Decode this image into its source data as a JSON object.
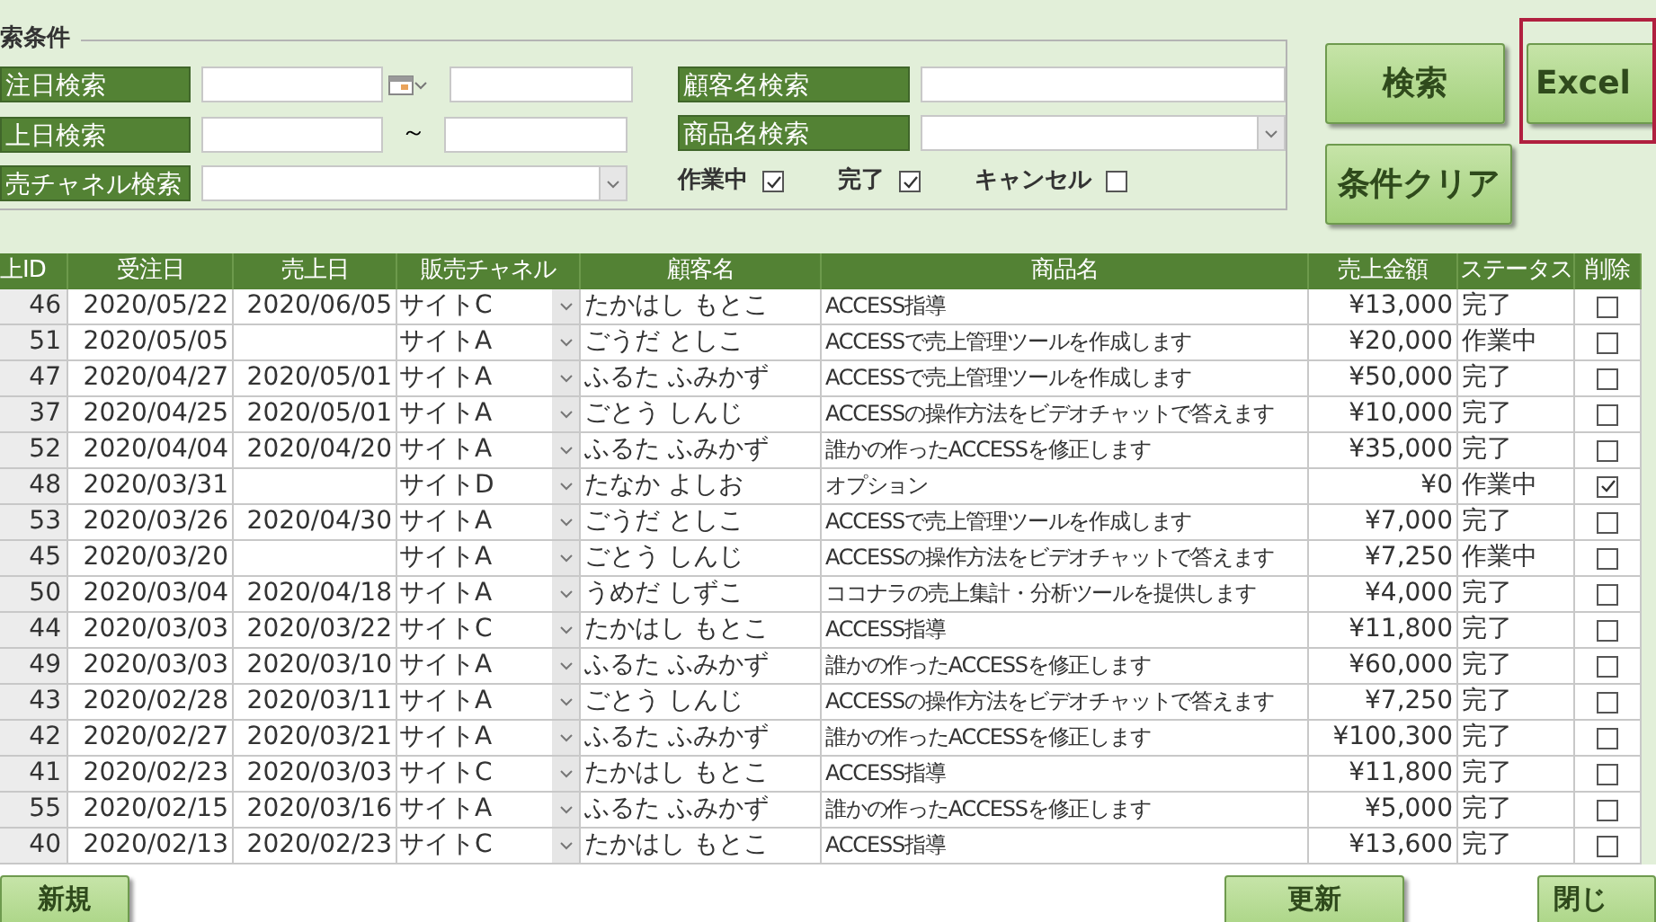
{
  "search_panel": {
    "legend": "索条件",
    "order_date": {
      "label": "注日検索"
    },
    "sales_date": {
      "label": "上日検索",
      "separator": "～"
    },
    "channel": {
      "label": "売チャネル検索"
    },
    "customer": {
      "label": "顧客名検索"
    },
    "product": {
      "label": "商品名検索"
    },
    "status_filters": [
      {
        "label": "作業中",
        "checked": true
      },
      {
        "label": "完了",
        "checked": true
      },
      {
        "label": "キャンセル",
        "checked": false
      }
    ]
  },
  "buttons": {
    "search": "検索",
    "excel": "Excel",
    "clear": "条件クリア"
  },
  "table": {
    "columns": [
      "上ID",
      "受注日",
      "売上日",
      "販売チャネル",
      "顧客名",
      "商品名",
      "売上金額",
      "ステータス",
      "削除"
    ],
    "rows": [
      {
        "id": "46",
        "order_date": "2020/05/22",
        "sales_date": "2020/06/05",
        "channel": "サイトC",
        "customer": "たかはし もとこ",
        "product": "ACCESS指導",
        "amount": "¥13,000",
        "status": "完了",
        "delete": false
      },
      {
        "id": "51",
        "order_date": "2020/05/05",
        "sales_date": "",
        "channel": "サイトA",
        "customer": "ごうだ としこ",
        "product": "ACCESSで売上管理ツールを作成します",
        "amount": "¥20,000",
        "status": "作業中",
        "delete": false
      },
      {
        "id": "47",
        "order_date": "2020/04/27",
        "sales_date": "2020/05/01",
        "channel": "サイトA",
        "customer": "ふるた ふみかず",
        "product": "ACCESSで売上管理ツールを作成します",
        "amount": "¥50,000",
        "status": "完了",
        "delete": false
      },
      {
        "id": "37",
        "order_date": "2020/04/25",
        "sales_date": "2020/05/01",
        "channel": "サイトA",
        "customer": "ごとう しんじ",
        "product": "ACCESSの操作方法をビデオチャットで答えます",
        "amount": "¥10,000",
        "status": "完了",
        "delete": false
      },
      {
        "id": "52",
        "order_date": "2020/04/04",
        "sales_date": "2020/04/20",
        "channel": "サイトA",
        "customer": "ふるた ふみかず",
        "product": "誰かの作ったACCESSを修正します",
        "amount": "¥35,000",
        "status": "完了",
        "delete": false
      },
      {
        "id": "48",
        "order_date": "2020/03/31",
        "sales_date": "",
        "channel": "サイトD",
        "customer": "たなか よしお",
        "product": "オプション",
        "amount": "¥0",
        "status": "作業中",
        "delete": true
      },
      {
        "id": "53",
        "order_date": "2020/03/26",
        "sales_date": "2020/04/30",
        "channel": "サイトA",
        "customer": "ごうだ としこ",
        "product": "ACCESSで売上管理ツールを作成します",
        "amount": "¥7,000",
        "status": "完了",
        "delete": false
      },
      {
        "id": "45",
        "order_date": "2020/03/20",
        "sales_date": "",
        "channel": "サイトA",
        "customer": "ごとう しんじ",
        "product": "ACCESSの操作方法をビデオチャットで答えます",
        "amount": "¥7,250",
        "status": "作業中",
        "delete": false
      },
      {
        "id": "50",
        "order_date": "2020/03/04",
        "sales_date": "2020/04/18",
        "channel": "サイトA",
        "customer": "うめだ しずこ",
        "product": "ココナラの売上集計・分析ツールを提供します",
        "amount": "¥4,000",
        "status": "完了",
        "delete": false
      },
      {
        "id": "44",
        "order_date": "2020/03/03",
        "sales_date": "2020/03/22",
        "channel": "サイトC",
        "customer": "たかはし もとこ",
        "product": "ACCESS指導",
        "amount": "¥11,800",
        "status": "完了",
        "delete": false
      },
      {
        "id": "49",
        "order_date": "2020/03/03",
        "sales_date": "2020/03/10",
        "channel": "サイトA",
        "customer": "ふるた ふみかず",
        "product": "誰かの作ったACCESSを修正します",
        "amount": "¥60,000",
        "status": "完了",
        "delete": false
      },
      {
        "id": "43",
        "order_date": "2020/02/28",
        "sales_date": "2020/03/11",
        "channel": "サイトA",
        "customer": "ごとう しんじ",
        "product": "ACCESSの操作方法をビデオチャットで答えます",
        "amount": "¥7,250",
        "status": "完了",
        "delete": false
      },
      {
        "id": "42",
        "order_date": "2020/02/27",
        "sales_date": "2020/03/21",
        "channel": "サイトA",
        "customer": "ふるた ふみかず",
        "product": "誰かの作ったACCESSを修正します",
        "amount": "¥100,300",
        "status": "完了",
        "delete": false
      },
      {
        "id": "41",
        "order_date": "2020/02/23",
        "sales_date": "2020/03/03",
        "channel": "サイトC",
        "customer": "たかはし もとこ",
        "product": "ACCESS指導",
        "amount": "¥11,800",
        "status": "完了",
        "delete": false
      },
      {
        "id": "55",
        "order_date": "2020/02/15",
        "sales_date": "2020/03/16",
        "channel": "サイトA",
        "customer": "ふるた ふみかず",
        "product": "誰かの作ったACCESSを修正します",
        "amount": "¥5,000",
        "status": "完了",
        "delete": false
      },
      {
        "id": "40",
        "order_date": "2020/02/13",
        "sales_date": "2020/02/23",
        "channel": "サイトC",
        "customer": "たかはし もとこ",
        "product": "ACCESS指導",
        "amount": "¥13,600",
        "status": "完了",
        "delete": false
      }
    ]
  },
  "footer_buttons": [
    "新規",
    "更新",
    "閉じ"
  ]
}
